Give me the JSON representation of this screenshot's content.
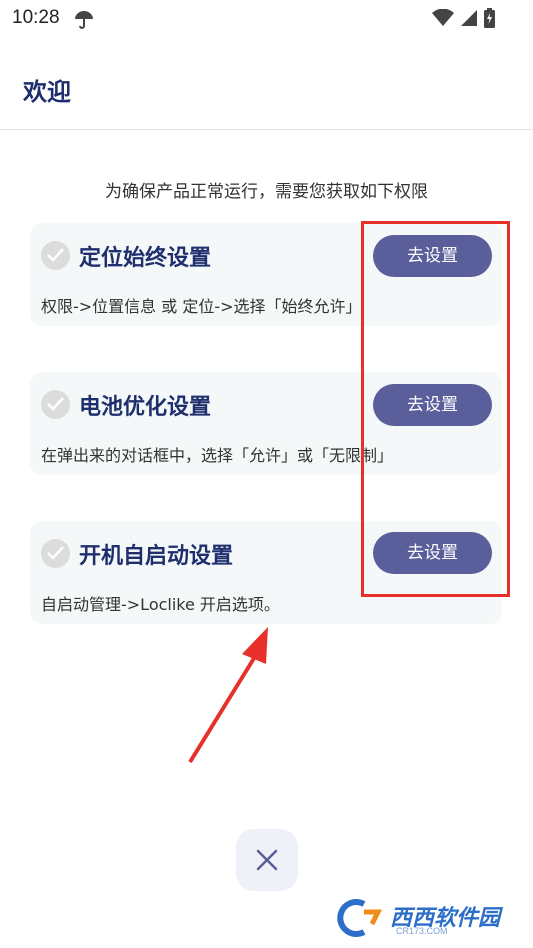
{
  "status_bar": {
    "time": "10:28",
    "icons": [
      "umbrella-icon",
      "wifi-icon",
      "cellular-signal-icon",
      "battery-charging-icon"
    ]
  },
  "app_bar": {
    "title": "欢迎"
  },
  "subtitle": "为确保产品正常运行，需要您获取如下权限",
  "cards": [
    {
      "title": "定位始终设置",
      "description": "权限->位置信息 或 定位->选择「始终允许」",
      "button": "去设置"
    },
    {
      "title": "电池优化设置",
      "description": "在弹出来的对话框中，选择「允许」或「无限制」",
      "button": "去设置"
    },
    {
      "title": "开机自启动设置",
      "description": "自启动管理->Loclike 开启选项。",
      "button": "去设置"
    }
  ],
  "watermark": {
    "text": "西西软件园",
    "domain": "CR173.COM"
  },
  "colors": {
    "title": "#1f2f6e",
    "button": "#5a5f9c",
    "card_bg": "#f5f8f8",
    "highlight": "#e8302a"
  }
}
